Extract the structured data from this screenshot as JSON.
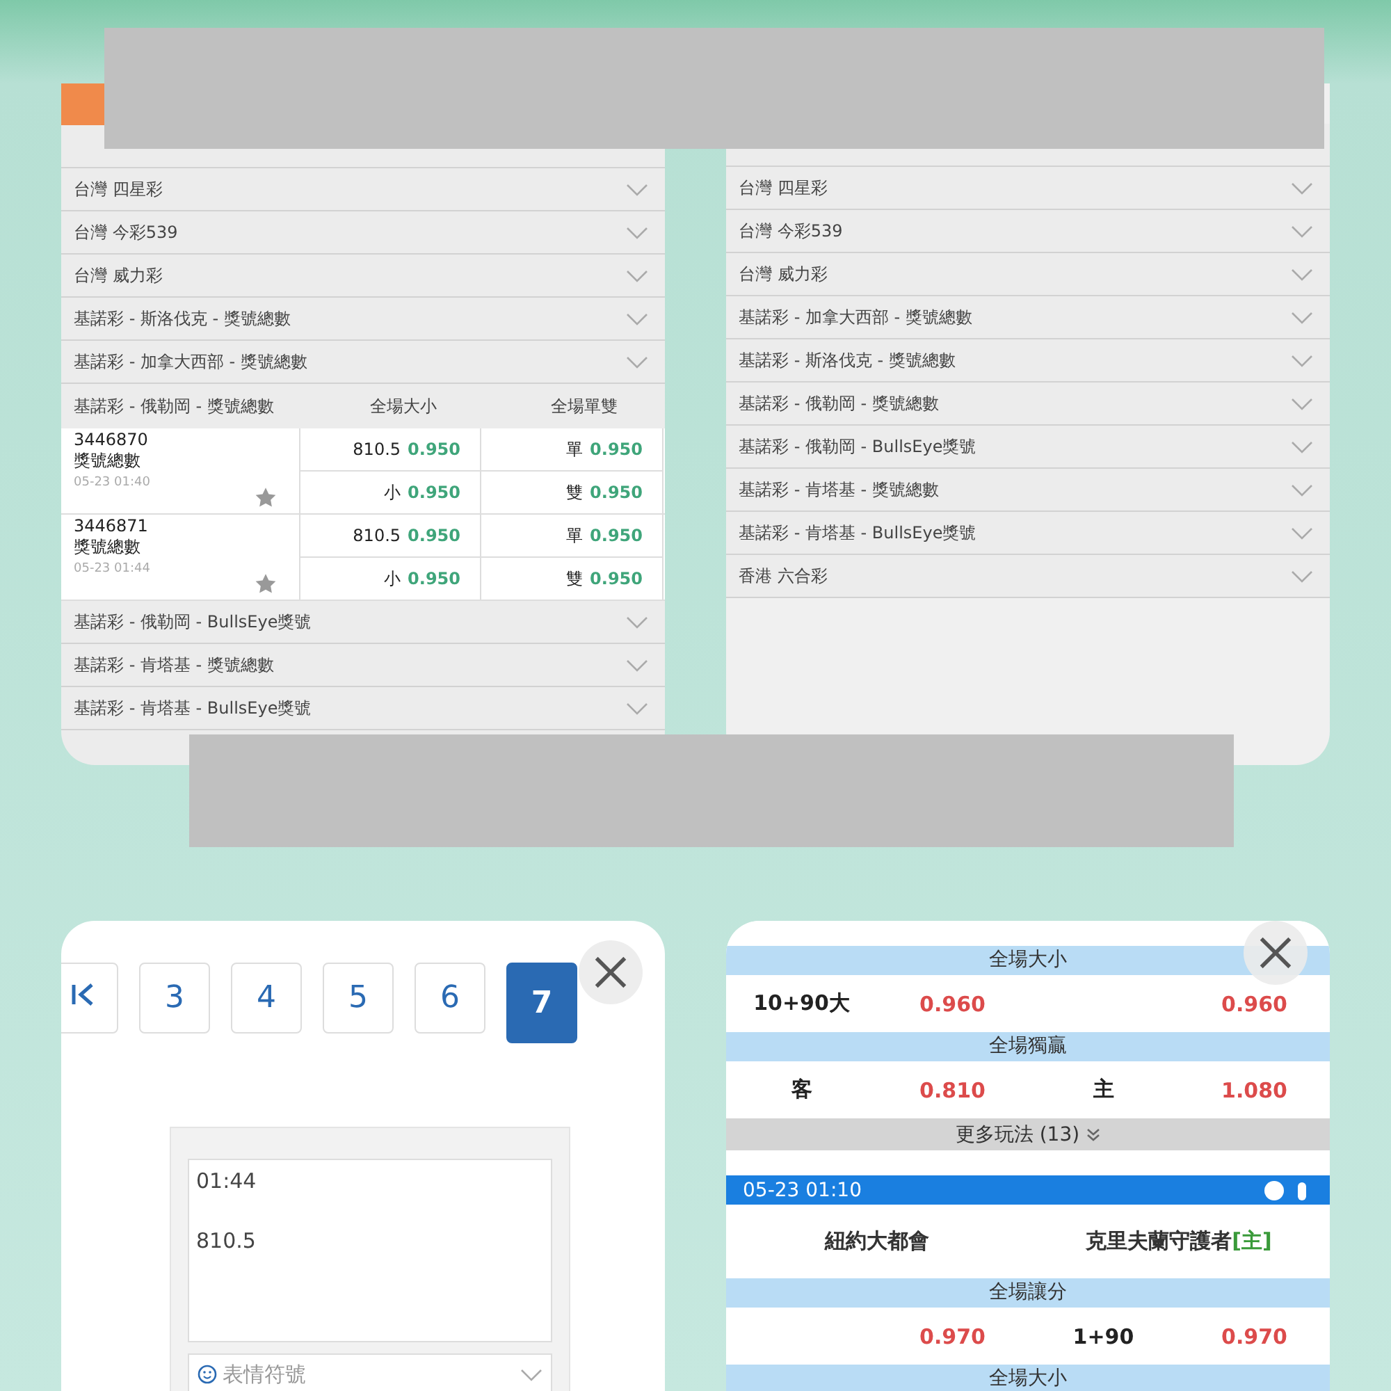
{
  "top_left_card": {
    "rows": [
      {
        "label": "台灣 四星彩"
      },
      {
        "label": "台灣 今彩539"
      },
      {
        "label": "台灣 威力彩"
      },
      {
        "label": "基諾彩 - 斯洛伐克 - 獎號總數"
      },
      {
        "label": "基諾彩 - 加拿大西部 - 獎號總數"
      }
    ],
    "expanded": {
      "title": "基諾彩 - 俄勒岡 - 獎號總數",
      "columns": [
        "全場大小",
        "全場單雙"
      ],
      "entries": [
        {
          "id": "3446870",
          "label": "獎號總數",
          "time": "05-23 01:40",
          "odds": [
            [
              "810.5",
              "0.950",
              "單",
              "0.950"
            ],
            [
              "小",
              "0.950",
              "雙",
              "0.950"
            ]
          ]
        },
        {
          "id": "3446871",
          "label": "獎號總數",
          "time": "05-23 01:44",
          "odds": [
            [
              "810.5",
              "0.950",
              "單",
              "0.950"
            ],
            [
              "小",
              "0.950",
              "雙",
              "0.950"
            ]
          ]
        }
      ]
    },
    "rows_after": [
      {
        "label": "基諾彩 - 俄勒岡 - BullsEye獎號"
      },
      {
        "label": "基諾彩 - 肯塔基 - 獎號總數"
      },
      {
        "label": "基諾彩 - 肯塔基 - BullsEye獎號"
      }
    ]
  },
  "top_right_card": {
    "rows": [
      {
        "label": "台灣 四星彩"
      },
      {
        "label": "台灣 今彩539"
      },
      {
        "label": "台灣 威力彩"
      },
      {
        "label": "基諾彩 - 加拿大西部 - 獎號總數"
      },
      {
        "label": "基諾彩 - 斯洛伐克 - 獎號總數"
      },
      {
        "label": "基諾彩 - 俄勒岡 - 獎號總數"
      },
      {
        "label": "基諾彩 - 俄勒岡 - BullsEye獎號"
      },
      {
        "label": "基諾彩 - 肯塔基 - 獎號總數"
      },
      {
        "label": "基諾彩 - 肯塔基 - BullsEye獎號"
      },
      {
        "label": "香港 六合彩"
      }
    ]
  },
  "bottom_left_card": {
    "pages": [
      {
        "label": "3",
        "selected": false
      },
      {
        "label": "4",
        "selected": false
      },
      {
        "label": "5",
        "selected": false
      },
      {
        "label": "6",
        "selected": false
      },
      {
        "label": "7",
        "selected": true
      }
    ],
    "message_lines": [
      "01:44",
      "810.5"
    ],
    "emoji_select": "表情符號"
  },
  "bottom_right_card": {
    "blocks": [
      {
        "kind": "section",
        "title": "全場大小"
      },
      {
        "kind": "odds",
        "cells": [
          "10+90大",
          "0.960",
          "",
          "0.960"
        ]
      },
      {
        "kind": "section",
        "title": "全場獨贏"
      },
      {
        "kind": "odds",
        "cells": [
          "客",
          "0.810",
          "主",
          "1.080"
        ]
      },
      {
        "kind": "more",
        "title": "更多玩法 (13)"
      },
      {
        "kind": "match",
        "time": "05-23 01:10",
        "away": "紐約大都會",
        "home": "克里夫蘭守護者",
        "home_tag": "[主]"
      },
      {
        "kind": "section",
        "title": "全場讓分"
      },
      {
        "kind": "odds",
        "cells": [
          "",
          "0.970",
          "1+90",
          "0.970"
        ]
      },
      {
        "kind": "section",
        "title": "全場大小"
      }
    ]
  }
}
